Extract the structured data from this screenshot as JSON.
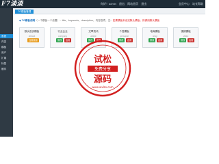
{
  "header": {
    "logo": "F7淡淡",
    "user_info": [
      "你好！admin",
      "退出",
      "网站首页",
      "退出"
    ],
    "links": [
      "会员中心",
      "站长帮助"
    ]
  },
  "sidebar": {
    "items": [
      "系统",
      "内容",
      "模板",
      "用户",
      "扩展",
      "标签",
      "缓存"
    ]
  },
  "subtab": {
    "label": "TG模板管理"
  },
  "notice": {
    "lead": "◆ TG模板说明",
    "text": "（一个模板一个设置）：",
    "detail": "title、keywords、description、内容选项，注：",
    "warn": "如果模板未设定默认模板，则调用默认模板"
  },
  "cards": [
    {
      "title": "默认首页模板",
      "sub": "default",
      "buttons": [
        "当前使用"
      ]
    },
    {
      "title": "行业企业",
      "sub": "company",
      "buttons": [
        "修改",
        "启用"
      ]
    },
    {
      "title": "文章资讯",
      "sub": "article",
      "buttons": [
        "修改",
        "启用"
      ]
    },
    {
      "title": "个性模板",
      "sub": "personal",
      "buttons": [
        "修改",
        "启用"
      ]
    },
    {
      "title": "电商模板",
      "sub": "shop",
      "buttons": [
        "修改",
        "启用"
      ]
    },
    {
      "title": "视频模板",
      "sub": "video",
      "buttons": [
        "修改",
        "启用"
      ]
    }
  ],
  "watermark": {
    "top": "试松",
    "middle": "免费分享",
    "bottom": "源码",
    "url": "www.wxlzv.com"
  },
  "colors": {
    "topbar": "#1d2b36",
    "sidebar": "#2f3a44",
    "accent": "#1e8fd8",
    "watermark": "#d21f1f"
  }
}
